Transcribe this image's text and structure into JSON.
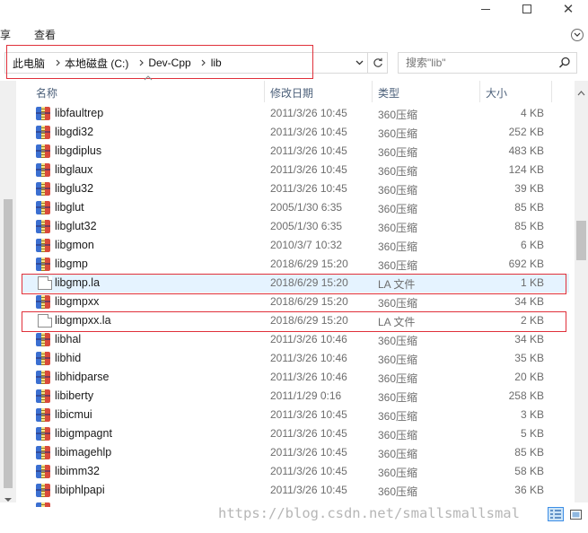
{
  "ribbon": {
    "tabs": [
      "享",
      "查看"
    ]
  },
  "address": {
    "crumbs": [
      "此电脑",
      "本地磁盘 (C:)",
      "Dev-Cpp",
      "lib"
    ]
  },
  "search": {
    "placeholder": "搜索\"lib\""
  },
  "columns": {
    "name": "名称",
    "date": "修改日期",
    "type": "类型",
    "size": "大小"
  },
  "files": [
    {
      "name": "libfaultrep",
      "date": "2011/3/26 10:45",
      "type": "360压缩",
      "size": "4 KB",
      "icon": "archive-icon"
    },
    {
      "name": "libgdi32",
      "date": "2011/3/26 10:45",
      "type": "360压缩",
      "size": "252 KB",
      "icon": "archive-icon"
    },
    {
      "name": "libgdiplus",
      "date": "2011/3/26 10:45",
      "type": "360压缩",
      "size": "483 KB",
      "icon": "archive-icon"
    },
    {
      "name": "libglaux",
      "date": "2011/3/26 10:45",
      "type": "360压缩",
      "size": "124 KB",
      "icon": "archive-icon"
    },
    {
      "name": "libglu32",
      "date": "2011/3/26 10:45",
      "type": "360压缩",
      "size": "39 KB",
      "icon": "archive-icon"
    },
    {
      "name": "libglut",
      "date": "2005/1/30 6:35",
      "type": "360压缩",
      "size": "85 KB",
      "icon": "archive-icon"
    },
    {
      "name": "libglut32",
      "date": "2005/1/30 6:35",
      "type": "360压缩",
      "size": "85 KB",
      "icon": "archive-icon"
    },
    {
      "name": "libgmon",
      "date": "2010/3/7 10:32",
      "type": "360压缩",
      "size": "6 KB",
      "icon": "archive-icon"
    },
    {
      "name": "libgmp",
      "date": "2018/6/29 15:20",
      "type": "360压缩",
      "size": "692 KB",
      "icon": "archive-icon"
    },
    {
      "name": "libgmp.la",
      "date": "2018/6/29 15:20",
      "type": "LA 文件",
      "size": "1 KB",
      "icon": "document-icon"
    },
    {
      "name": "libgmpxx",
      "date": "2018/6/29 15:20",
      "type": "360压缩",
      "size": "34 KB",
      "icon": "archive-icon"
    },
    {
      "name": "libgmpxx.la",
      "date": "2018/6/29 15:20",
      "type": "LA 文件",
      "size": "2 KB",
      "icon": "document-icon"
    },
    {
      "name": "libhal",
      "date": "2011/3/26 10:46",
      "type": "360压缩",
      "size": "34 KB",
      "icon": "archive-icon"
    },
    {
      "name": "libhid",
      "date": "2011/3/26 10:46",
      "type": "360压缩",
      "size": "35 KB",
      "icon": "archive-icon"
    },
    {
      "name": "libhidparse",
      "date": "2011/3/26 10:46",
      "type": "360压缩",
      "size": "20 KB",
      "icon": "archive-icon"
    },
    {
      "name": "libiberty",
      "date": "2011/1/29 0:16",
      "type": "360压缩",
      "size": "258 KB",
      "icon": "archive-icon"
    },
    {
      "name": "libicmui",
      "date": "2011/3/26 10:45",
      "type": "360压缩",
      "size": "3 KB",
      "icon": "archive-icon"
    },
    {
      "name": "libigmpagnt",
      "date": "2011/3/26 10:45",
      "type": "360压缩",
      "size": "5 KB",
      "icon": "archive-icon"
    },
    {
      "name": "libimagehlp",
      "date": "2011/3/26 10:45",
      "type": "360压缩",
      "size": "85 KB",
      "icon": "archive-icon"
    },
    {
      "name": "libimm32",
      "date": "2011/3/26 10:45",
      "type": "360压缩",
      "size": "58 KB",
      "icon": "archive-icon"
    },
    {
      "name": "libiphlpapi",
      "date": "2011/3/26 10:45",
      "type": "360压缩",
      "size": "36 KB",
      "icon": "archive-icon"
    }
  ],
  "watermark": "https://blog.csdn.net/smallsmallsmal",
  "colors": {
    "highlight_border": "#e0303a",
    "selected_row": "#e5f3ff",
    "header_text": "#4c607a",
    "meta_text": "#6d6d6d"
  }
}
